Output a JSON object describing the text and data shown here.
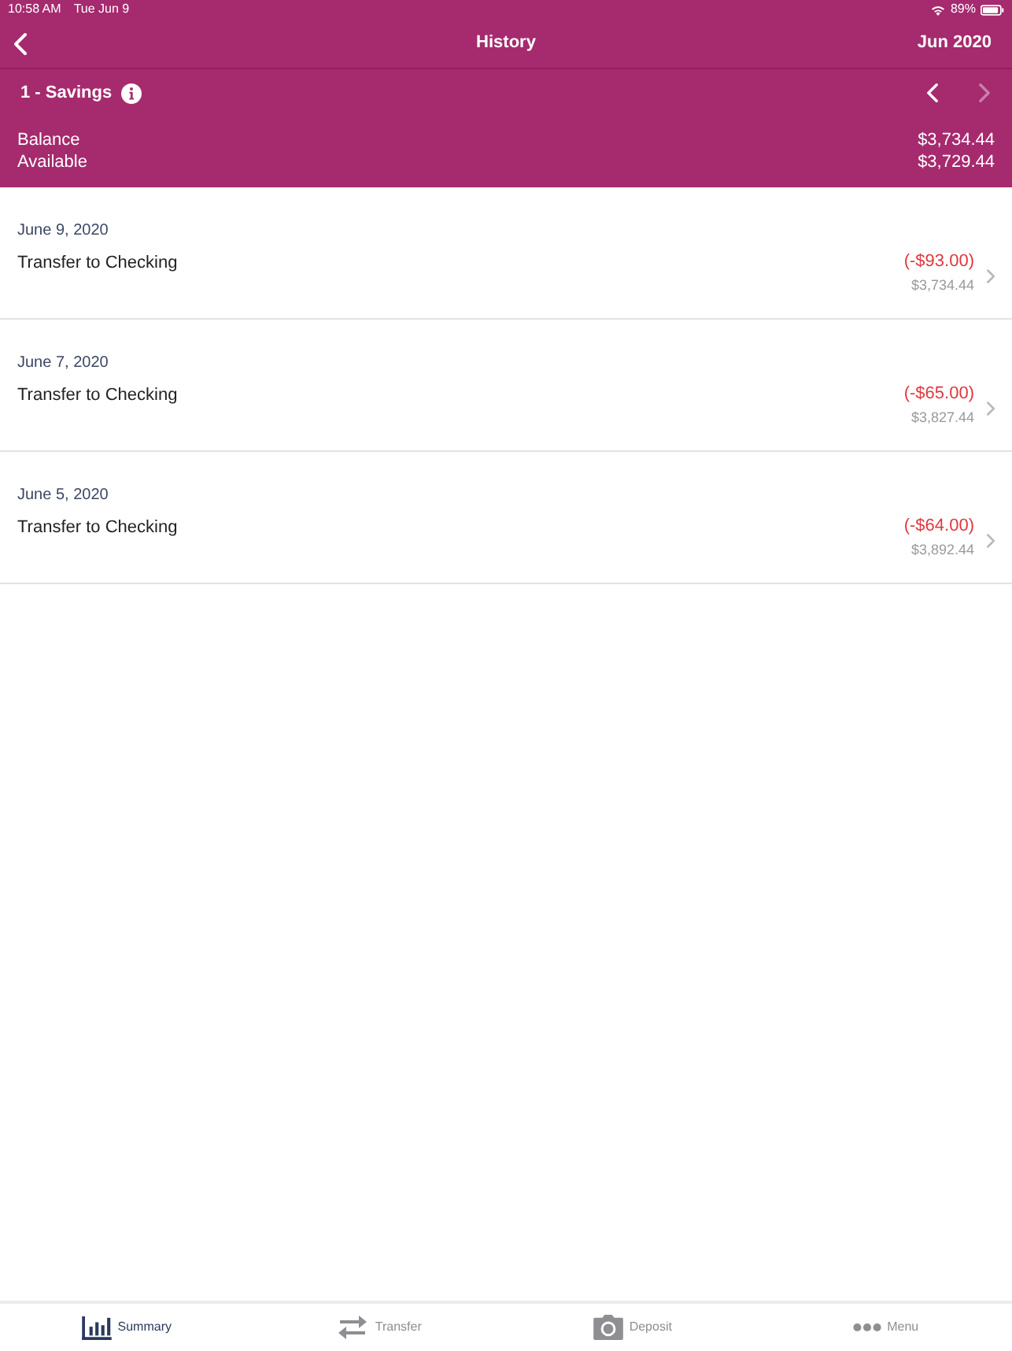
{
  "status_bar": {
    "time": "10:58 AM",
    "date": "Tue Jun 9",
    "battery": "89%"
  },
  "nav": {
    "title": "History",
    "period": "Jun 2020"
  },
  "account": {
    "name": "1 - Savings",
    "previous_disabled": false,
    "next_disabled": true
  },
  "summary": [
    {
      "label": "Balance",
      "value": "$3,734.44"
    },
    {
      "label": "Available",
      "value": "$3,729.44"
    }
  ],
  "days": [
    {
      "date": "June 9, 2020",
      "transactions": [
        {
          "description": "Transfer to Checking",
          "amount": "(-$93.00)",
          "kind": "debit",
          "running_balance": "$3,734.44"
        }
      ]
    },
    {
      "date": "June 7, 2020",
      "transactions": [
        {
          "description": "Transfer to Checking",
          "amount": "(-$65.00)",
          "kind": "debit",
          "running_balance": "$3,827.44"
        }
      ]
    },
    {
      "date": "June 5, 2020",
      "transactions": [
        {
          "description": "Transfer to Checking",
          "amount": "(-$64.00)",
          "kind": "debit",
          "running_balance": "$3,892.44"
        }
      ]
    }
  ],
  "tab_bar": [
    {
      "label": "Summary",
      "kind": "summary",
      "selected": true
    },
    {
      "label": "Transfer",
      "kind": "transfer",
      "selected": false
    },
    {
      "label": "Deposit",
      "kind": "deposit",
      "selected": false
    },
    {
      "label": "Menu",
      "kind": "menu",
      "selected": false
    }
  ]
}
